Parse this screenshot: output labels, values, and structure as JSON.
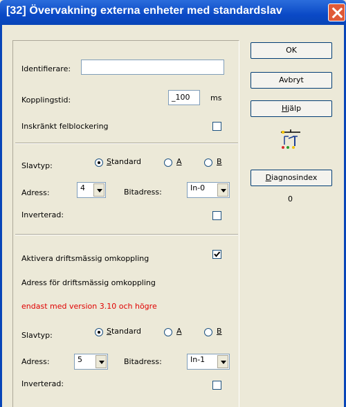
{
  "window": {
    "title": "[32] Övervakning externa enheter med standardslav"
  },
  "general": {
    "identifier_label": "Identifierare:",
    "identifier_value": "",
    "coupling_time_label": "Kopplingstid:",
    "coupling_time_value": "_100",
    "coupling_time_unit": "ms",
    "restricted_fault_blocking_label": "Inskränkt felblockering",
    "restricted_fault_blocking_checked": false
  },
  "slave1": {
    "slave_type_label": "Slavtyp:",
    "options": [
      {
        "label": "Standard",
        "mnemonic": "S",
        "rest": "tandard",
        "checked": true
      },
      {
        "label": "A",
        "mnemonic": "A",
        "rest": "",
        "checked": false
      },
      {
        "label": "B",
        "mnemonic": "B",
        "rest": "",
        "checked": false
      }
    ],
    "address_label": "Adress:",
    "address_value": "4",
    "bit_address_label": "Bitadress:",
    "bit_address_value": "In-0",
    "inverted_label": "Inverterad:",
    "inverted_checked": false
  },
  "switchover": {
    "activate_label": "Aktivera driftsmässig  omkoppling",
    "activate_checked": true,
    "address_heading": "Adress för driftsmässig omkoppling",
    "version_note": "endast med version 3.10 och högre",
    "note_color": "#e00000"
  },
  "slave2": {
    "slave_type_label": "Slavtyp:",
    "options": [
      {
        "label": "Standard",
        "mnemonic": "S",
        "rest": "tandard",
        "checked": true
      },
      {
        "label": "A",
        "mnemonic": "A",
        "rest": "",
        "checked": false
      },
      {
        "label": "B",
        "mnemonic": "B",
        "rest": "",
        "checked": false
      }
    ],
    "address_label": "Adress:",
    "address_value": "5",
    "bit_address_label": "Bitadress:",
    "bit_address_value": "In-1",
    "inverted_label": "Inverterad:",
    "inverted_checked": false
  },
  "buttons": {
    "ok": "OK",
    "cancel": "Avbryt",
    "help_mnemonic": "H",
    "help_rest": "jälp",
    "diag_mnemonic": "D",
    "diag_rest": "iagnosindex"
  },
  "diagnosis_index_value": "0",
  "icons": {
    "circuit": "relay-contact-icon"
  }
}
